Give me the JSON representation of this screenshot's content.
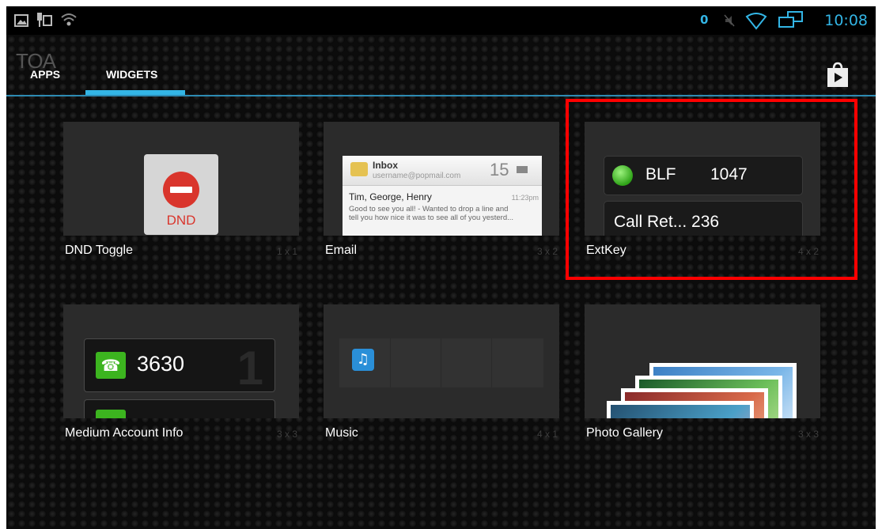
{
  "status_bar": {
    "time": "10:08",
    "left_icons": [
      "gallery-icon",
      "usb-icon",
      "wifi-question-icon"
    ],
    "right_icons": [
      "notification-0-icon",
      "mute-icon",
      "wifi-icon",
      "network-icon"
    ],
    "notification_count": "0",
    "accent_color": "#33b5e5"
  },
  "brand": {
    "logo_text": "TOA"
  },
  "tabs": [
    {
      "label": "APPS",
      "selected": false
    },
    {
      "label": "WIDGETS",
      "selected": true
    }
  ],
  "toolbar": {
    "store_icon": "play-store-icon"
  },
  "widgets": [
    {
      "name": "DND Toggle",
      "size": "1 x 1",
      "preview": {
        "label": "DND"
      }
    },
    {
      "name": "Email",
      "size": "3 x 2",
      "preview": {
        "title": "Inbox",
        "account": "username@popmail.com",
        "count": "15",
        "from": "Tim, George, Henry",
        "time": "11:23pm",
        "snippet_1": "Good to see you all! - Wanted to drop a line and",
        "snippet_2": "tell you how nice it was to see all of you yesterd..."
      }
    },
    {
      "name": "ExtKey",
      "size": "4 x 2",
      "preview": {
        "row1_label": "BLF",
        "row1_number": "1047",
        "row2_label": "Call Ret... 236"
      }
    },
    {
      "name": "Medium Account Info",
      "size": "3 x 3",
      "preview": {
        "number": "3630"
      }
    },
    {
      "name": "Music",
      "size": "4 x 1"
    },
    {
      "name": "Photo Gallery",
      "size": "3 x 3"
    }
  ],
  "highlight": {
    "target": "ExtKey",
    "color": "#ff0000"
  }
}
